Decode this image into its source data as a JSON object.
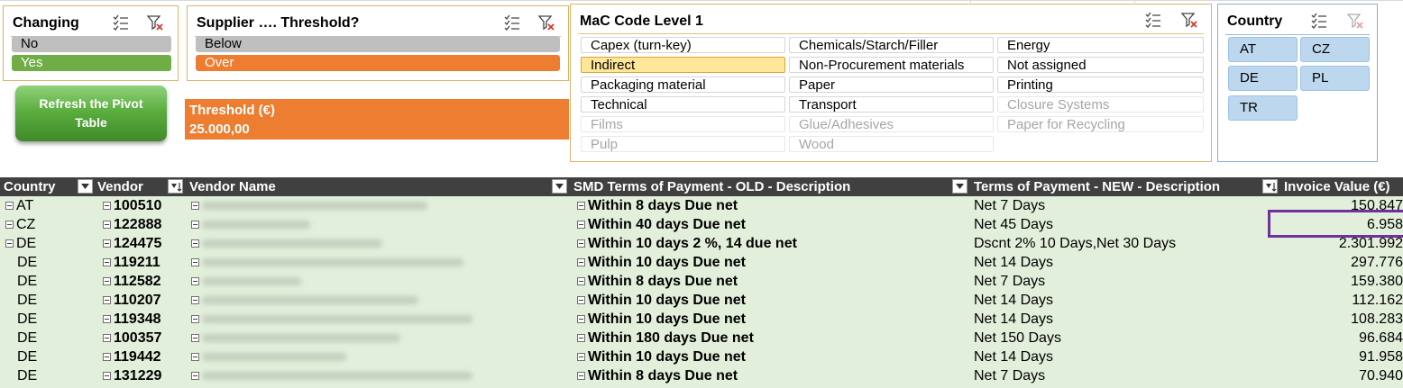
{
  "slicers": {
    "changing": {
      "title": "Changing",
      "items": [
        "No",
        "Yes"
      ]
    },
    "supplier": {
      "title": "Supplier …. Threshold?",
      "items": [
        "Below",
        "Over"
      ]
    },
    "mac": {
      "title": "MaC Code Level 1",
      "items": [
        "Capex (turn-key)",
        "Chemicals/Starch/Filler",
        "Energy",
        "Indirect",
        "Non-Procurement materials",
        "Not assigned",
        "Packaging material",
        "Paper",
        "Printing",
        "Technical",
        "Transport",
        "Closure Systems",
        "Films",
        "Glue/Adhesives",
        "Paper for Recycling",
        "Pulp",
        "Wood"
      ]
    },
    "country": {
      "title": "Country",
      "items": [
        "AT",
        "CZ",
        "DE",
        "PL",
        "TR"
      ]
    }
  },
  "refresh_button": {
    "label": "Refresh the Pivot Table"
  },
  "threshold": {
    "label": "Threshold (€)",
    "value": "25.000,00"
  },
  "pivot": {
    "headers": {
      "country": "Country",
      "vendor": "Vendor",
      "vendor_name": "Vendor Name",
      "old_terms": "SMD Terms of Payment - OLD - Description",
      "new_terms": "Terms of Payment - NEW - Description",
      "invoice": "Invoice Value (€)"
    },
    "rows": [
      {
        "country": "AT",
        "vendor": "100510",
        "old": "Within 8 days Due net",
        "new": "Net 7 Days",
        "value": "150.847"
      },
      {
        "country": "CZ",
        "vendor": "122888",
        "old": "Within 40 days Due net",
        "new": "Net 45 Days",
        "value": "6.958"
      },
      {
        "country": "DE",
        "vendor": "124475",
        "old": "Within 10 days 2 %, 14 due net",
        "new": "Dscnt 2% 10 Days,Net 30 Days",
        "value": "2.301.992"
      },
      {
        "country": "DE",
        "vendor": "119211",
        "old": "Within 10 days Due net",
        "new": "Net 14 Days",
        "value": "297.776"
      },
      {
        "country": "DE",
        "vendor": "112582",
        "old": "Within 8 days Due net",
        "new": "Net 7 Days",
        "value": "159.380"
      },
      {
        "country": "DE",
        "vendor": "110207",
        "old": "Within 10 days Due net",
        "new": "Net 14 Days",
        "value": "112.162"
      },
      {
        "country": "DE",
        "vendor": "119348",
        "old": "Within 10 days Due net",
        "new": "Net 14 Days",
        "value": "108.283"
      },
      {
        "country": "DE",
        "vendor": "100357",
        "old": "Within 180 days Due net",
        "new": "Net 150 Days",
        "value": "96.684"
      },
      {
        "country": "DE",
        "vendor": "119442",
        "old": "Within 10 days Due net",
        "new": "Net 14 Days",
        "value": "91.958"
      },
      {
        "country": "DE",
        "vendor": "131229",
        "old": "Within 8 days Due net",
        "new": "Net 7 Days",
        "value": "70.940"
      }
    ]
  },
  "colors": {
    "accent_orange": "#ed7d31",
    "selected_green": "#70ad47",
    "body_green": "#e2efda",
    "header_dark": "#404040",
    "highlight_purple": "#7030a0"
  }
}
